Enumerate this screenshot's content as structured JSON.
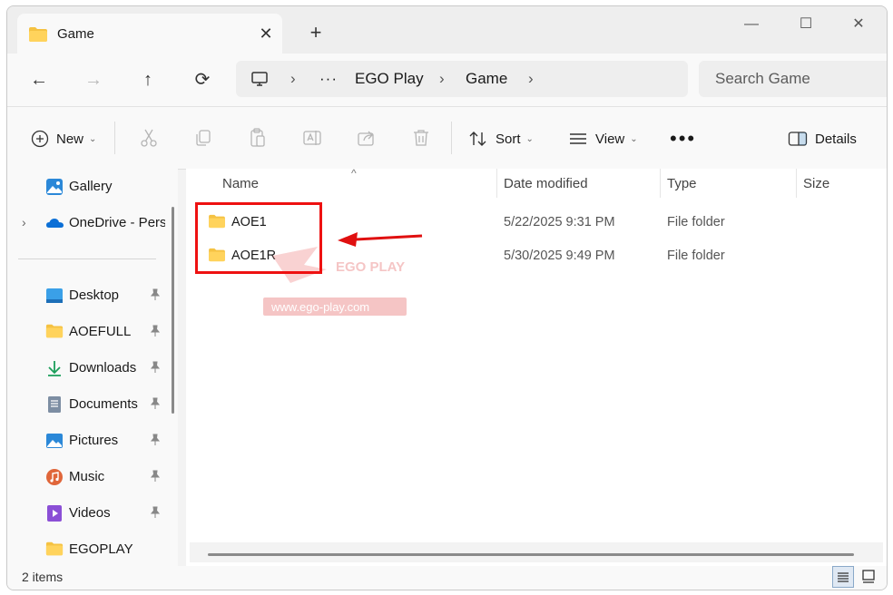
{
  "window": {
    "tab_title": "Game",
    "icons": {
      "tab": "folder-icon",
      "close_tab": "close-icon",
      "new_tab": "plus-icon",
      "minimize": "minimize-icon",
      "maximize": "maximize-icon",
      "close": "close-icon"
    }
  },
  "address": {
    "breadcrumb": [
      "EGO Play",
      "Game"
    ],
    "search_placeholder": "Search Game"
  },
  "toolbar": {
    "new_label": "New",
    "sort_label": "Sort",
    "view_label": "View",
    "details_label": "Details"
  },
  "sidebar": {
    "top_items": [
      {
        "label": "Gallery",
        "icon": "gallery-icon"
      },
      {
        "label": "OneDrive - Perso",
        "icon": "onedrive-icon"
      }
    ],
    "pinned_items": [
      {
        "label": "Desktop",
        "icon": "desktop-icon"
      },
      {
        "label": "AOEFULL",
        "icon": "folder-icon"
      },
      {
        "label": "Downloads",
        "icon": "download-icon"
      },
      {
        "label": "Documents",
        "icon": "documents-icon"
      },
      {
        "label": "Pictures",
        "icon": "pictures-icon"
      },
      {
        "label": "Music",
        "icon": "music-icon"
      },
      {
        "label": "Videos",
        "icon": "videos-icon"
      },
      {
        "label": "EGOPLAY",
        "icon": "folder-icon"
      }
    ]
  },
  "table": {
    "columns": [
      "Name",
      "Date modified",
      "Type",
      "Size"
    ],
    "rows": [
      {
        "name": "AOE1",
        "date": "5/22/2025 9:31 PM",
        "type": "File folder"
      },
      {
        "name": "AOE1R",
        "date": "5/30/2025 9:49 PM",
        "type": "File folder"
      }
    ]
  },
  "status": {
    "count": "2 items"
  },
  "watermark": {
    "brand": "EGO PLAY",
    "url": "www.ego-play.com"
  },
  "colors": {
    "folder": "#f5c242",
    "highlight": "#ee1111",
    "accent": "#0067c0"
  }
}
